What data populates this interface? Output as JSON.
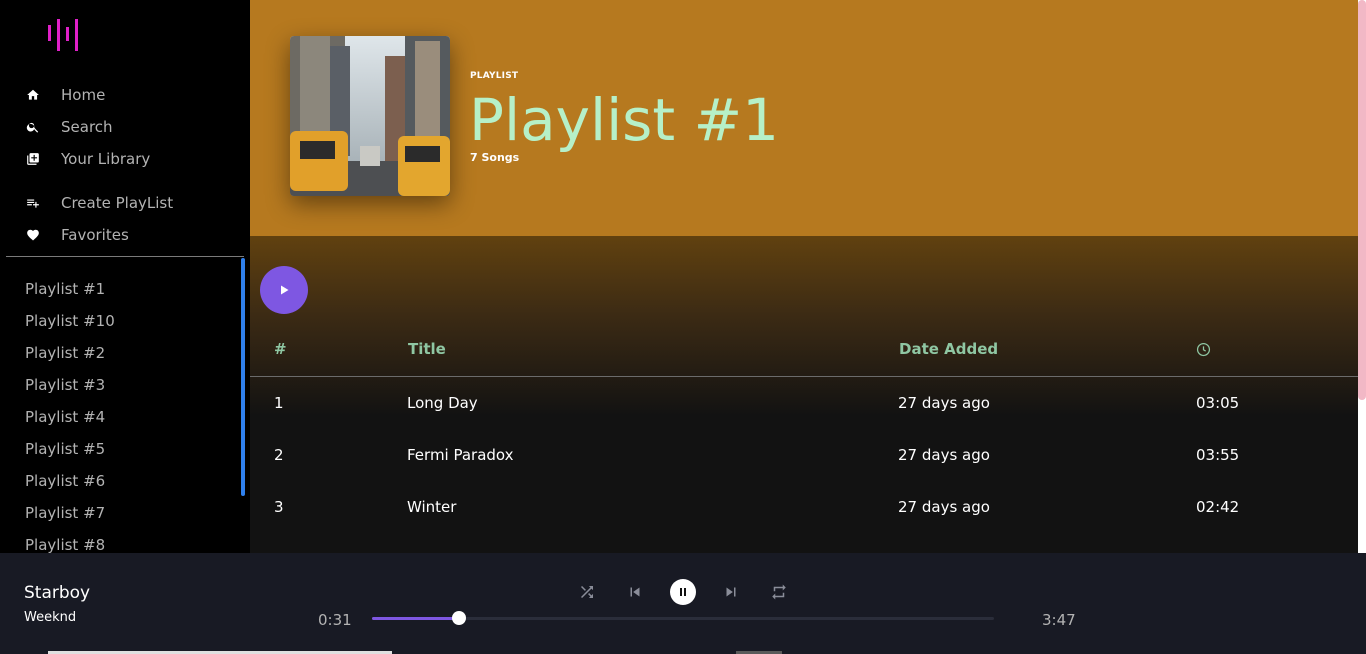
{
  "colors": {
    "accent": "#7e57e2",
    "hero_bg": "#b6791f",
    "title_color": "#b6f0c8",
    "header_text": "#8fc7a3",
    "logo": "#e020c8"
  },
  "logo": {
    "icon": "sound-bars-icon"
  },
  "nav": {
    "items": [
      {
        "label": "Home",
        "icon": "home-icon"
      },
      {
        "label": "Search",
        "icon": "search-icon"
      },
      {
        "label": "Your Library",
        "icon": "library-icon"
      }
    ],
    "actions": [
      {
        "label": "Create PlayList",
        "icon": "add-playlist-icon"
      },
      {
        "label": "Favorites",
        "icon": "heart-icon"
      }
    ]
  },
  "playlists": [
    "Playlist #1",
    "Playlist #10",
    "Playlist #2",
    "Playlist #3",
    "Playlist #4",
    "Playlist #5",
    "Playlist #6",
    "Playlist #7",
    "Playlist #8"
  ],
  "header": {
    "type_label": "PLAYLIST",
    "title": "Playlist #1",
    "song_count": "7 Songs"
  },
  "table": {
    "columns": {
      "index": "#",
      "title": "Title",
      "date_added": "Date Added",
      "duration_icon": "clock-icon"
    },
    "rows": [
      {
        "index": "1",
        "title": "Long Day",
        "date_added": "27 days ago",
        "duration": "03:05"
      },
      {
        "index": "2",
        "title": "Fermi Paradox",
        "date_added": "27 days ago",
        "duration": "03:55"
      },
      {
        "index": "3",
        "title": "Winter",
        "date_added": "27 days ago",
        "duration": "02:42"
      }
    ]
  },
  "player": {
    "track_title": "Starboy",
    "artist": "Weeknd",
    "elapsed": "0:31",
    "total": "3:47",
    "progress": 0.14
  }
}
